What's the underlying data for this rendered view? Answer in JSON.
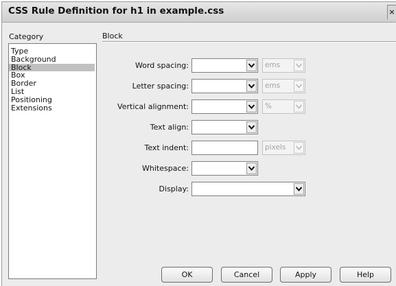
{
  "window": {
    "title": "CSS Rule Definition for h1 in example.css",
    "close_glyph": "×"
  },
  "category": {
    "header": "Category",
    "items": [
      "Type",
      "Background",
      "Block",
      "Box",
      "Border",
      "List",
      "Positioning",
      "Extensions"
    ],
    "selected": "Block"
  },
  "section": {
    "title": "Block"
  },
  "fields": {
    "word_spacing": {
      "label": "Word spacing:",
      "value": "",
      "unit": "ems"
    },
    "letter_spacing": {
      "label": "Letter spacing:",
      "value": "",
      "unit": "ems"
    },
    "vertical_alignment": {
      "label": "Vertical alignment:",
      "value": "",
      "unit": "%"
    },
    "text_align": {
      "label": "Text align:",
      "value": ""
    },
    "text_indent": {
      "label": "Text indent:",
      "value": "",
      "unit": "pixels"
    },
    "whitespace": {
      "label": "Whitespace:",
      "value": ""
    },
    "display": {
      "label": "Display:",
      "value": ""
    }
  },
  "buttons": {
    "ok": "OK",
    "cancel": "Cancel",
    "apply": "Apply",
    "help": "Help"
  },
  "icons": {
    "dropdown": "chevron-down-icon",
    "close": "close-icon"
  }
}
